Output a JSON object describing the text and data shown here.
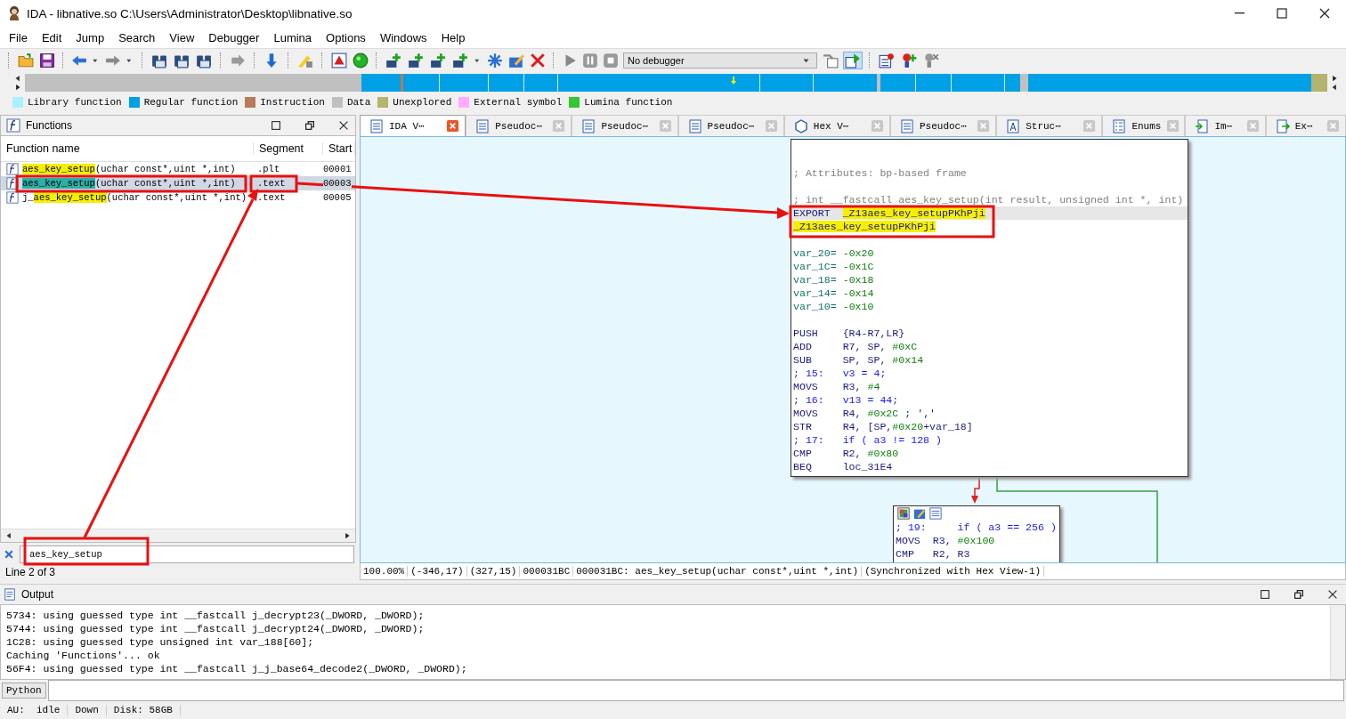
{
  "window": {
    "title": "IDA - libnative.so C:\\Users\\Administrator\\Desktop\\libnative.so"
  },
  "menu": [
    "File",
    "Edit",
    "Jump",
    "Search",
    "View",
    "Debugger",
    "Lumina",
    "Options",
    "Windows",
    "Help"
  ],
  "toolbar": {
    "debugger_select": "No debugger"
  },
  "legend": [
    {
      "label": "Library function",
      "color": "#aaf0ff"
    },
    {
      "label": "Regular function",
      "color": "#00a0e6"
    },
    {
      "label": "Instruction",
      "color": "#b97a57"
    },
    {
      "label": "Data",
      "color": "#c0c0c0"
    },
    {
      "label": "Unexplored",
      "color": "#b4b46e"
    },
    {
      "label": "External symbol",
      "color": "#ffaaff"
    },
    {
      "label": "Lumina function",
      "color": "#32c832"
    }
  ],
  "functions_panel": {
    "title": "Functions",
    "columns": [
      "Function name",
      "Segment",
      "Start"
    ],
    "rows": [
      {
        "match": "aes_key_setup",
        "after": "(uchar const*,uint *,int)",
        "segment": ".plt",
        "start": "00001",
        "selected": false
      },
      {
        "match": "aes_key_setup",
        "after": "(uchar const*,uint *,int)",
        "segment": ".text",
        "start": "00003",
        "selected": true
      },
      {
        "prefix": "j_",
        "match": "aes_key_setup",
        "after": "(uchar const*,uint *,int)",
        "segment": ".text",
        "start": "00005",
        "selected": false
      }
    ],
    "search": {
      "value": "aes_key_setup"
    },
    "position": "Line 2 of 3"
  },
  "tabs": [
    {
      "label": "IDA V⋯",
      "kind": "listing",
      "selected": true
    },
    {
      "label": "Pseudoc⋯",
      "kind": "listing",
      "selected": false
    },
    {
      "label": "Pseudoc⋯",
      "kind": "listing",
      "selected": false
    },
    {
      "label": "Pseudoc⋯",
      "kind": "listing",
      "selected": false
    },
    {
      "label": "Hex V⋯",
      "kind": "hex",
      "selected": false
    },
    {
      "label": "Pseudoc⋯",
      "kind": "listing",
      "selected": false
    },
    {
      "label": "Struc⋯",
      "kind": "struct",
      "selected": false
    },
    {
      "label": "Enums",
      "kind": "enum",
      "selected": false
    },
    {
      "label": "Im⋯",
      "kind": "import",
      "selected": false
    },
    {
      "label": "Ex⋯",
      "kind": "export",
      "selected": false
    }
  ],
  "graph": {
    "nodes": [
      {
        "lines": [
          {
            "kind": "comment",
            "text": "; Attributes: bp-based frame"
          },
          {
            "kind": "comment",
            "text": "; int __fastcall aes_key_setup(int result, unsigned int *, int)",
            "space_before": true
          },
          {
            "kind": "insn",
            "op": "EXPORT",
            "args": "_Z13aes_key_setupPKhPji",
            "current": true,
            "highlight": true
          },
          {
            "kind": "label",
            "text": "_Z13aes_key_setupPKhPji",
            "highlight": true
          },
          {
            "kind": "var",
            "name": "var_20=",
            "value": "-0x20",
            "space_before": true
          },
          {
            "kind": "var",
            "name": "var_1C=",
            "value": "-0x1C"
          },
          {
            "kind": "var",
            "name": "var_18=",
            "value": "-0x18"
          },
          {
            "kind": "var",
            "name": "var_14=",
            "value": "-0x14"
          },
          {
            "kind": "var",
            "name": "var_10=",
            "value": "-0x10"
          },
          {
            "kind": "insn",
            "op": "PUSH",
            "args": "{R4-R7,LR}",
            "space_before": true
          },
          {
            "kind": "insn",
            "op": "ADD",
            "args": "R7, SP, #0xC"
          },
          {
            "kind": "insn",
            "op": "SUB",
            "args": "SP, SP, #0x14"
          },
          {
            "kind": "pseudo",
            "op": "; 15:",
            "args": "v3 = 4;"
          },
          {
            "kind": "insn",
            "op": "MOVS",
            "args": "R3, #4"
          },
          {
            "kind": "pseudo",
            "op": "; 16:",
            "args": "v13 = 44;"
          },
          {
            "kind": "insn",
            "op": "MOVS",
            "args": "R4, #0x2C ; ','"
          },
          {
            "kind": "insn",
            "op": "STR",
            "args": "R4, [SP,#0x20+var_18]"
          },
          {
            "kind": "pseudo",
            "op": "; 17:",
            "args": "if ( a3 != 128 )"
          },
          {
            "kind": "insn",
            "op": "CMP",
            "args": "R2, #0x80"
          },
          {
            "kind": "insn",
            "op": "BEQ",
            "args": "loc_31E4"
          }
        ]
      },
      {
        "lines": [
          {
            "kind": "pseudo",
            "op": "; 19:",
            "args": "    if ( a3 == 256 )"
          },
          {
            "kind": "insn",
            "op": "MOVS",
            "args": "R3, #0x100"
          },
          {
            "kind": "insn",
            "op": "CMP",
            "args": "R2, R3"
          }
        ]
      }
    ],
    "status": [
      "100.00%",
      "(-346,17)",
      "(327,15)",
      "000031BC",
      "000031BC: aes_key_setup(uchar const*,uint *,int)",
      "(Synchronized with Hex View-1)"
    ]
  },
  "output": {
    "title": "Output",
    "lines": [
      "5734: using guessed type int __fastcall j_decrypt23(_DWORD, _DWORD);",
      "5744: using guessed type int __fastcall j_decrypt24(_DWORD, _DWORD);",
      "1C28: using guessed type unsigned int var_188[60];",
      "Caching 'Functions'... ok",
      "56F4: using guessed type int __fastcall j_j_base64_decode2(_DWORD, _DWORD);"
    ]
  },
  "python": {
    "label": "Python"
  },
  "status_bar": [
    "AU:  idle",
    "Down",
    "Disk: 58GB"
  ]
}
